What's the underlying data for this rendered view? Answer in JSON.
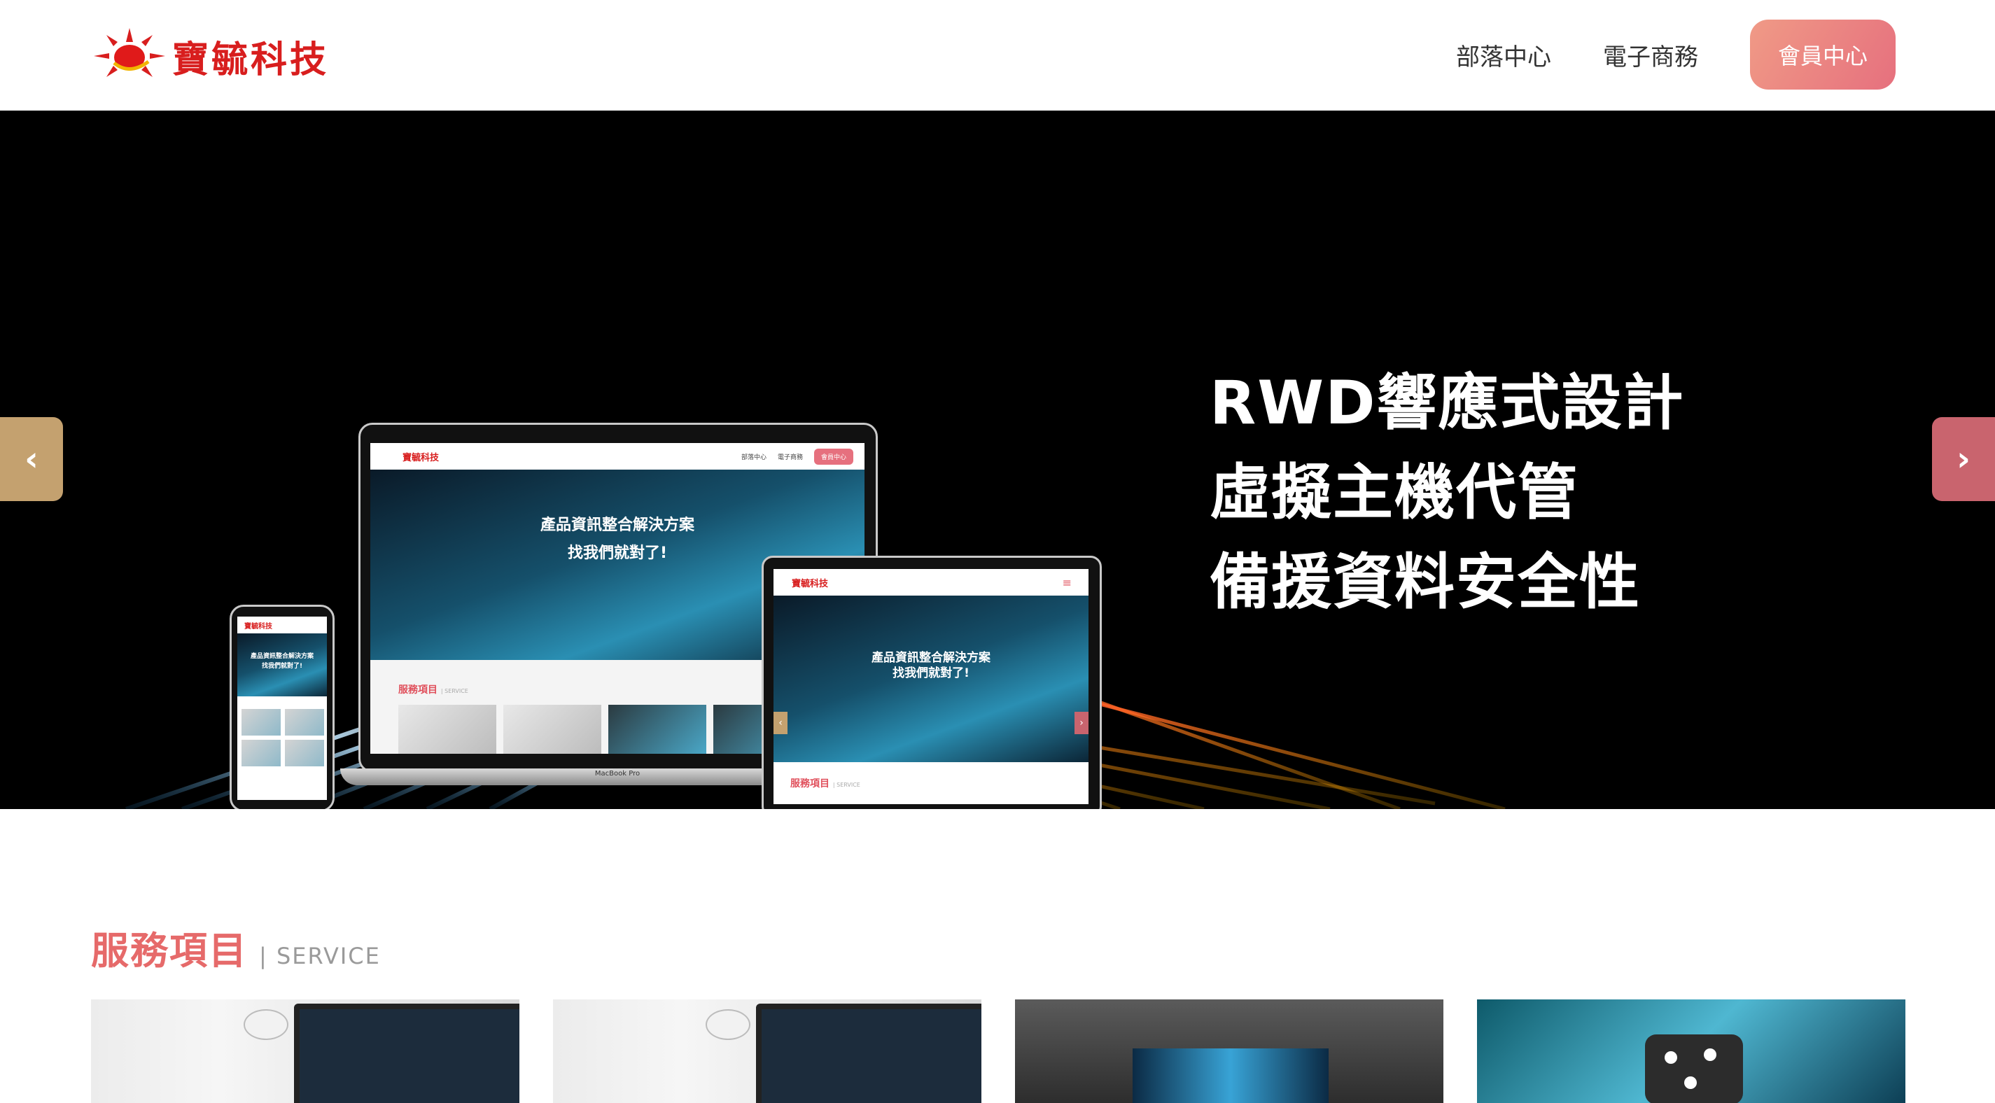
{
  "header": {
    "logo_text": "寶毓科技",
    "nav": [
      "部落中心",
      "電子商務"
    ],
    "cta": "會員中心"
  },
  "hero": {
    "lines": [
      "RWD響應式設計",
      "虛擬主機代管",
      "備援資料安全性"
    ],
    "slide_count": 2,
    "active_slide": 1,
    "mockup": {
      "logo": "寶毓科技",
      "nav": [
        "部落中心",
        "電子商務"
      ],
      "cta": "會員中心",
      "headline_1": "產品資訊整合解決方案",
      "headline_2": "找我們就對了!",
      "service_zh": "服務項目",
      "service_en": "| SERVICE",
      "laptop_brand": "MacBook Pro"
    }
  },
  "services": {
    "title_zh": "服務項目",
    "title_en": "| SERVICE"
  },
  "colors": {
    "accent": "#e66a6a",
    "cta_gradient_start": "#f09a86",
    "cta_gradient_end": "#e6707e",
    "arrow_left": "#c4a16f",
    "arrow_right": "#c9646e",
    "logo_red": "#d81e1e"
  }
}
